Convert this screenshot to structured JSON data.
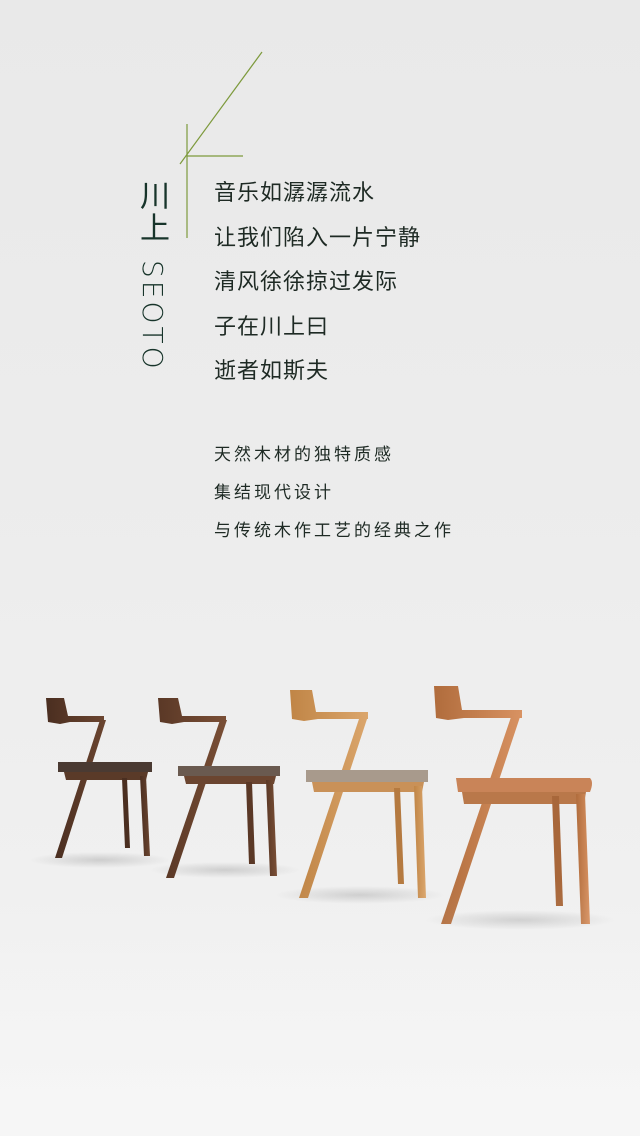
{
  "brand": {
    "name_cn": "川上",
    "name_en": "SEOTO"
  },
  "poem": {
    "lines": [
      "音乐如潺潺流水",
      "让我们陷入一片宁静",
      "清风徐徐掠过发际",
      "子在川上曰",
      "逝者如斯夫"
    ]
  },
  "description": {
    "lines": [
      "天然木材的独特质感",
      "集结现代设计",
      "与传统木作工艺的经典之作"
    ]
  },
  "colors": {
    "background": "#ececec",
    "brand_text": "#17342a",
    "accent_line": "#7d9a3c",
    "walnut": "#5a3a28",
    "oak": "#c99158",
    "cherry": "#b9784a",
    "fabric_dark": "#4a3a32",
    "fabric_light": "#a89a8c"
  }
}
